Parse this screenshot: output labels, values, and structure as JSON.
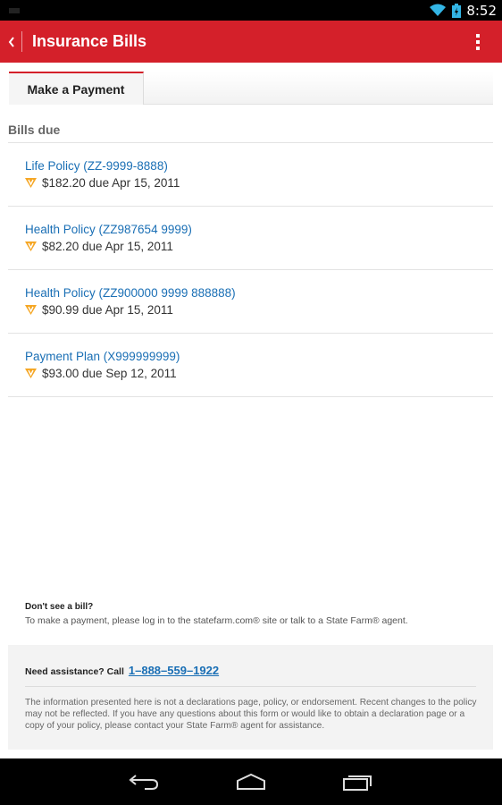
{
  "status_bar": {
    "time": "8:52"
  },
  "action_bar": {
    "title": "Insurance Bills"
  },
  "tabs": [
    {
      "label": "Make a Payment",
      "active": true
    }
  ],
  "bills_section": {
    "header": "Bills due",
    "items": [
      {
        "title": "Life Policy (ZZ-9999-8888)",
        "amount_due": "$182.20 due Apr 15, 2011"
      },
      {
        "title": "Health Policy (ZZ987654 9999)",
        "amount_due": "$82.20 due Apr 15, 2011"
      },
      {
        "title": "Health Policy (ZZ900000 9999 888888)",
        "amount_due": "$90.99 due Apr 15, 2011"
      },
      {
        "title": "Payment Plan (X999999999)",
        "amount_due": "$93.00 due Sep 12, 2011"
      }
    ]
  },
  "no_bill": {
    "title": "Don't see a bill?",
    "text": "To make a payment, please log in to the statefarm.com® site or talk to a State Farm® agent."
  },
  "assistance": {
    "label": "Need assistance?  Call",
    "phone": "1–888–559–1922",
    "disclaimer": "The information presented here is not a declarations page, policy, or endorsement. Recent changes to the policy may not be reflected. If you have any questions about this form or would like to obtain a declaration page or a copy of your policy, please contact your State Farm® agent for assistance."
  },
  "colors": {
    "brand_red": "#d4202a",
    "link_blue": "#1a6fb5",
    "due_icon_orange": "#f5a623",
    "wifi_blue": "#33b5e5"
  },
  "icons": {
    "back": "chevron-left-icon",
    "overflow": "overflow-menu-icon",
    "due": "due-warning-icon",
    "nav_back": "nav-back-icon",
    "nav_home": "nav-home-icon",
    "nav_recents": "nav-recents-icon"
  }
}
